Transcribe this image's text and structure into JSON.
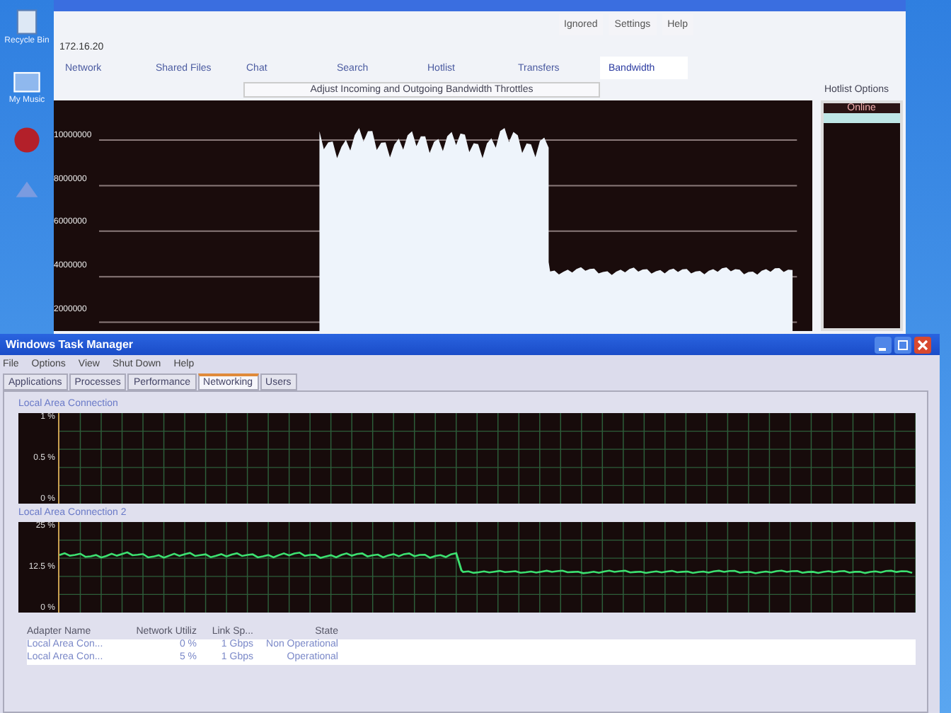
{
  "desktop_icons": [
    {
      "kind": "bin",
      "label": "Recycle Bin"
    },
    {
      "kind": "folder",
      "label": "My Music"
    },
    {
      "kind": "app"
    },
    {
      "kind": "network"
    }
  ],
  "bandwidth_window": {
    "toolbar_buttons": [
      "Ignored",
      "Settings",
      "Help"
    ],
    "host": "172.16.20",
    "nav_tabs": [
      {
        "label": "Network",
        "selected": false
      },
      {
        "label": "Shared Files",
        "selected": false
      },
      {
        "label": "Chat",
        "selected": false
      },
      {
        "label": "Search",
        "selected": false
      },
      {
        "label": "Hotlist",
        "selected": false
      },
      {
        "label": "Transfers",
        "selected": false
      },
      {
        "label": "Bandwidth",
        "selected": true
      }
    ],
    "throttle_button": "Adjust Incoming and Outgoing Bandwidth Throttles",
    "hotlist_options": "Hotlist Options",
    "y_axis_labels": [
      "10000000",
      "8000000",
      "6000000",
      "4000000",
      "2000000"
    ],
    "hotlist_header": "Online"
  },
  "task_manager": {
    "title": "Windows Task Manager",
    "menu": [
      "File",
      "Options",
      "View",
      "Shut Down",
      "Help"
    ],
    "tabs": [
      {
        "label": "Applications",
        "selected": false
      },
      {
        "label": "Processes",
        "selected": false
      },
      {
        "label": "Performance",
        "selected": false
      },
      {
        "label": "Networking",
        "selected": true
      },
      {
        "label": "Users",
        "selected": false
      }
    ],
    "graphs": [
      {
        "label": "Local Area Connection",
        "y_labels": [
          "1 %",
          "0.5 %",
          "0 %"
        ],
        "kind": "idle"
      },
      {
        "label": "Local Area Connection 2",
        "y_labels": [
          "25 %",
          "12.5 %",
          "0 %"
        ],
        "kind": "traffic"
      }
    ],
    "table": {
      "columns": [
        "Adapter Name",
        "Network Utiliz",
        "Link Sp...",
        "State"
      ],
      "rows": [
        [
          "Local Area Con...",
          "0 %",
          "1 Gbps",
          "Non Operational"
        ],
        [
          "Local Area Con...",
          "5 %",
          "1 Gbps",
          "Operational"
        ]
      ]
    }
  }
}
